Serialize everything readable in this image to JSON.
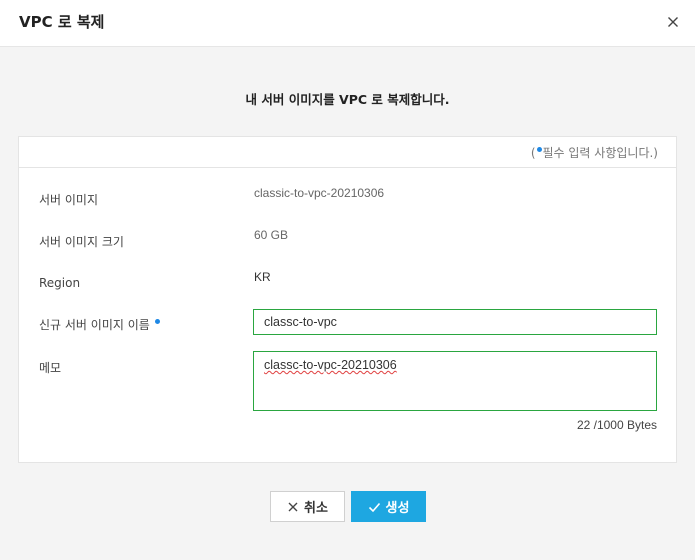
{
  "dialog": {
    "title": "VPC 로 복제",
    "subtitle": "내 서버 이미지를 VPC 로 복제합니다."
  },
  "form": {
    "required_note_prefix": "(",
    "required_note_suffix": "필수 입력 사항입니다.)",
    "rows": {
      "image_label": "서버 이미지",
      "image_value": "classic-to-vpc-20210306",
      "size_label": "서버 이미지 크기",
      "size_value": "60 GB",
      "region_label": "Region",
      "region_value": "KR",
      "new_name_label": "신규 서버 이미지 이름",
      "new_name_value": "classc-to-vpc",
      "memo_label": "메모",
      "memo_value": "classc-to-vpc-20210306"
    },
    "byte_count": "22 /1000 Bytes"
  },
  "buttons": {
    "cancel_label": "취소",
    "create_label": "생성"
  },
  "icons": {
    "close": "close-icon",
    "cancel": "x-icon",
    "create": "check-icon",
    "required": "required-dot-icon"
  },
  "colors": {
    "accent": "#1ea7e1",
    "input_border": "#2aa640",
    "required_dot": "#1e88e5"
  }
}
